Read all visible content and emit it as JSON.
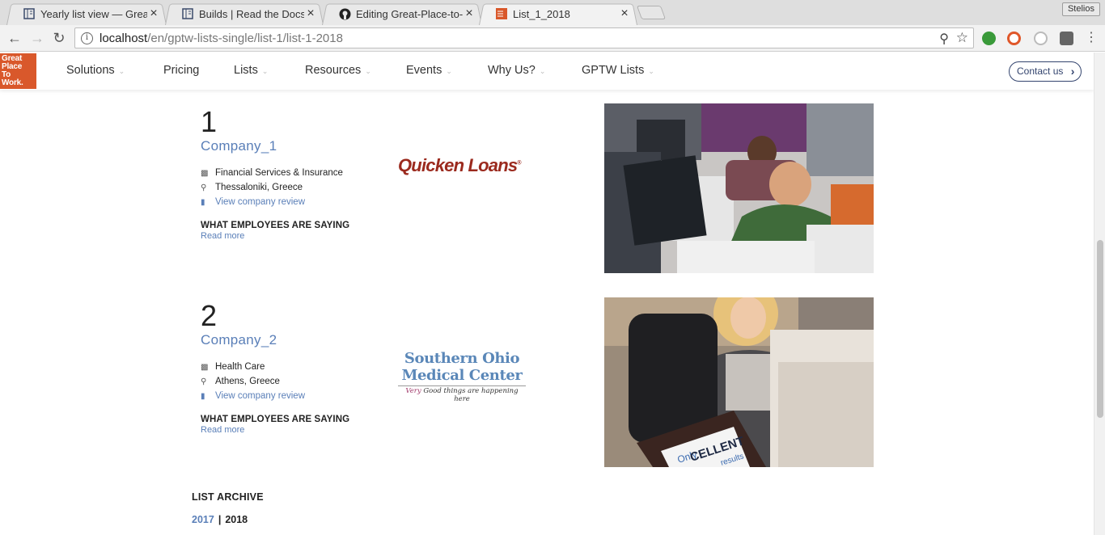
{
  "browser": {
    "tabs": [
      {
        "title": "Yearly list view — Great",
        "active": false
      },
      {
        "title": "Builds | Read the Docs",
        "active": false
      },
      {
        "title": "Editing Great-Place-to-W",
        "active": false
      },
      {
        "title": "List_1_2018",
        "active": true
      }
    ],
    "close_glyph": "×",
    "profile_name": "Stelios",
    "url_host": "localhost",
    "url_path": "/en/gptw-lists-single/list-1/list-1-2018"
  },
  "site": {
    "logo_lines": [
      "Great",
      "Place",
      "To",
      "Work."
    ],
    "menu": [
      "Solutions",
      "Pricing",
      "Lists",
      "Resources",
      "Events",
      "Why Us?",
      "GPTW Lists"
    ],
    "contact_label": "Contact us"
  },
  "entries": [
    {
      "rank": "1",
      "company": "Company_1",
      "industry": "Financial Services & Insurance",
      "location": "Thessaloniki, Greece",
      "review_link": "View company review",
      "says_heading": "WHAT EMPLOYEES ARE SAYING",
      "read_more": "Read more",
      "logo_text": "Quicken Loans"
    },
    {
      "rank": "2",
      "company": "Company_2",
      "industry": "Health Care",
      "location": "Athens, Greece",
      "review_link": "View company review",
      "says_heading": "WHAT EMPLOYEES ARE SAYING",
      "read_more": "Read more",
      "logo_line1": "Southern Ohio",
      "logo_line2": "Medical Center",
      "logo_tag_very": "Very",
      "logo_tag": "Good things are happening here",
      "photo_sign_line1": "Only",
      "photo_sign_line2": "CELLENT",
      "photo_sign_line3": "results"
    }
  ],
  "archive": {
    "title": "LIST ARCHIVE",
    "years": [
      "2017",
      "2018"
    ],
    "separator": "|"
  },
  "colors": {
    "brand_orange": "#d9582b",
    "link_blue": "#5a7fb8",
    "navy": "#33446e",
    "quicken_red": "#9b2a1e"
  }
}
